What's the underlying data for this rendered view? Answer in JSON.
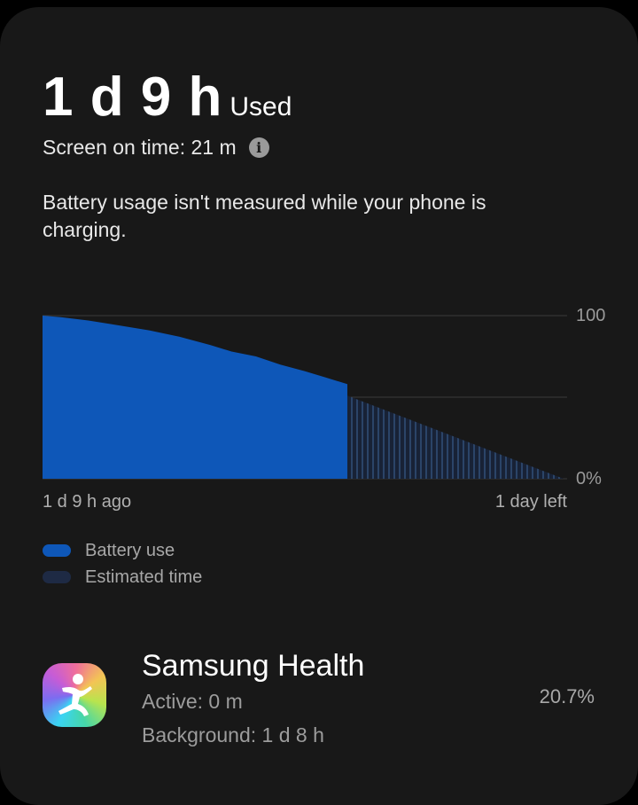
{
  "summary": {
    "duration": "1 d 9 h",
    "used_label": "Used",
    "screen_on_time": "Screen on time: 21 m",
    "charging_note": "Battery usage isn't measured while your phone is charging."
  },
  "chart_data": {
    "type": "area",
    "y_ticks": [
      "100",
      "0%"
    ],
    "ylim": [
      0,
      100
    ],
    "x_start_label": "1 d 9 h ago",
    "x_end_label": "1 day left",
    "series": [
      {
        "name": "Battery use",
        "color": "#0e57b8",
        "points": [
          [
            0,
            100
          ],
          [
            0.06,
            99
          ],
          [
            0.15,
            97
          ],
          [
            0.25,
            94
          ],
          [
            0.35,
            91
          ],
          [
            0.45,
            87
          ],
          [
            0.55,
            82
          ],
          [
            0.62,
            78
          ],
          [
            0.7,
            75
          ],
          [
            0.78,
            70
          ],
          [
            0.86,
            66
          ],
          [
            0.93,
            62
          ],
          [
            1.0,
            58
          ],
          [
            1.0,
            51
          ]
        ]
      },
      {
        "name": "Estimated time",
        "color": "#233a5c",
        "points": [
          [
            0,
            51
          ],
          [
            1,
            0
          ]
        ]
      }
    ]
  },
  "legend": [
    {
      "label": "Battery use",
      "color": "#0e57b8"
    },
    {
      "label": "Estimated time",
      "color": "#1e2a44"
    }
  ],
  "apps": [
    {
      "name": "Samsung Health",
      "active": "Active: 0 m",
      "background": "Background: 1 d 8 h",
      "percent": "20.7%",
      "icon": "samsung-health-icon"
    }
  ]
}
